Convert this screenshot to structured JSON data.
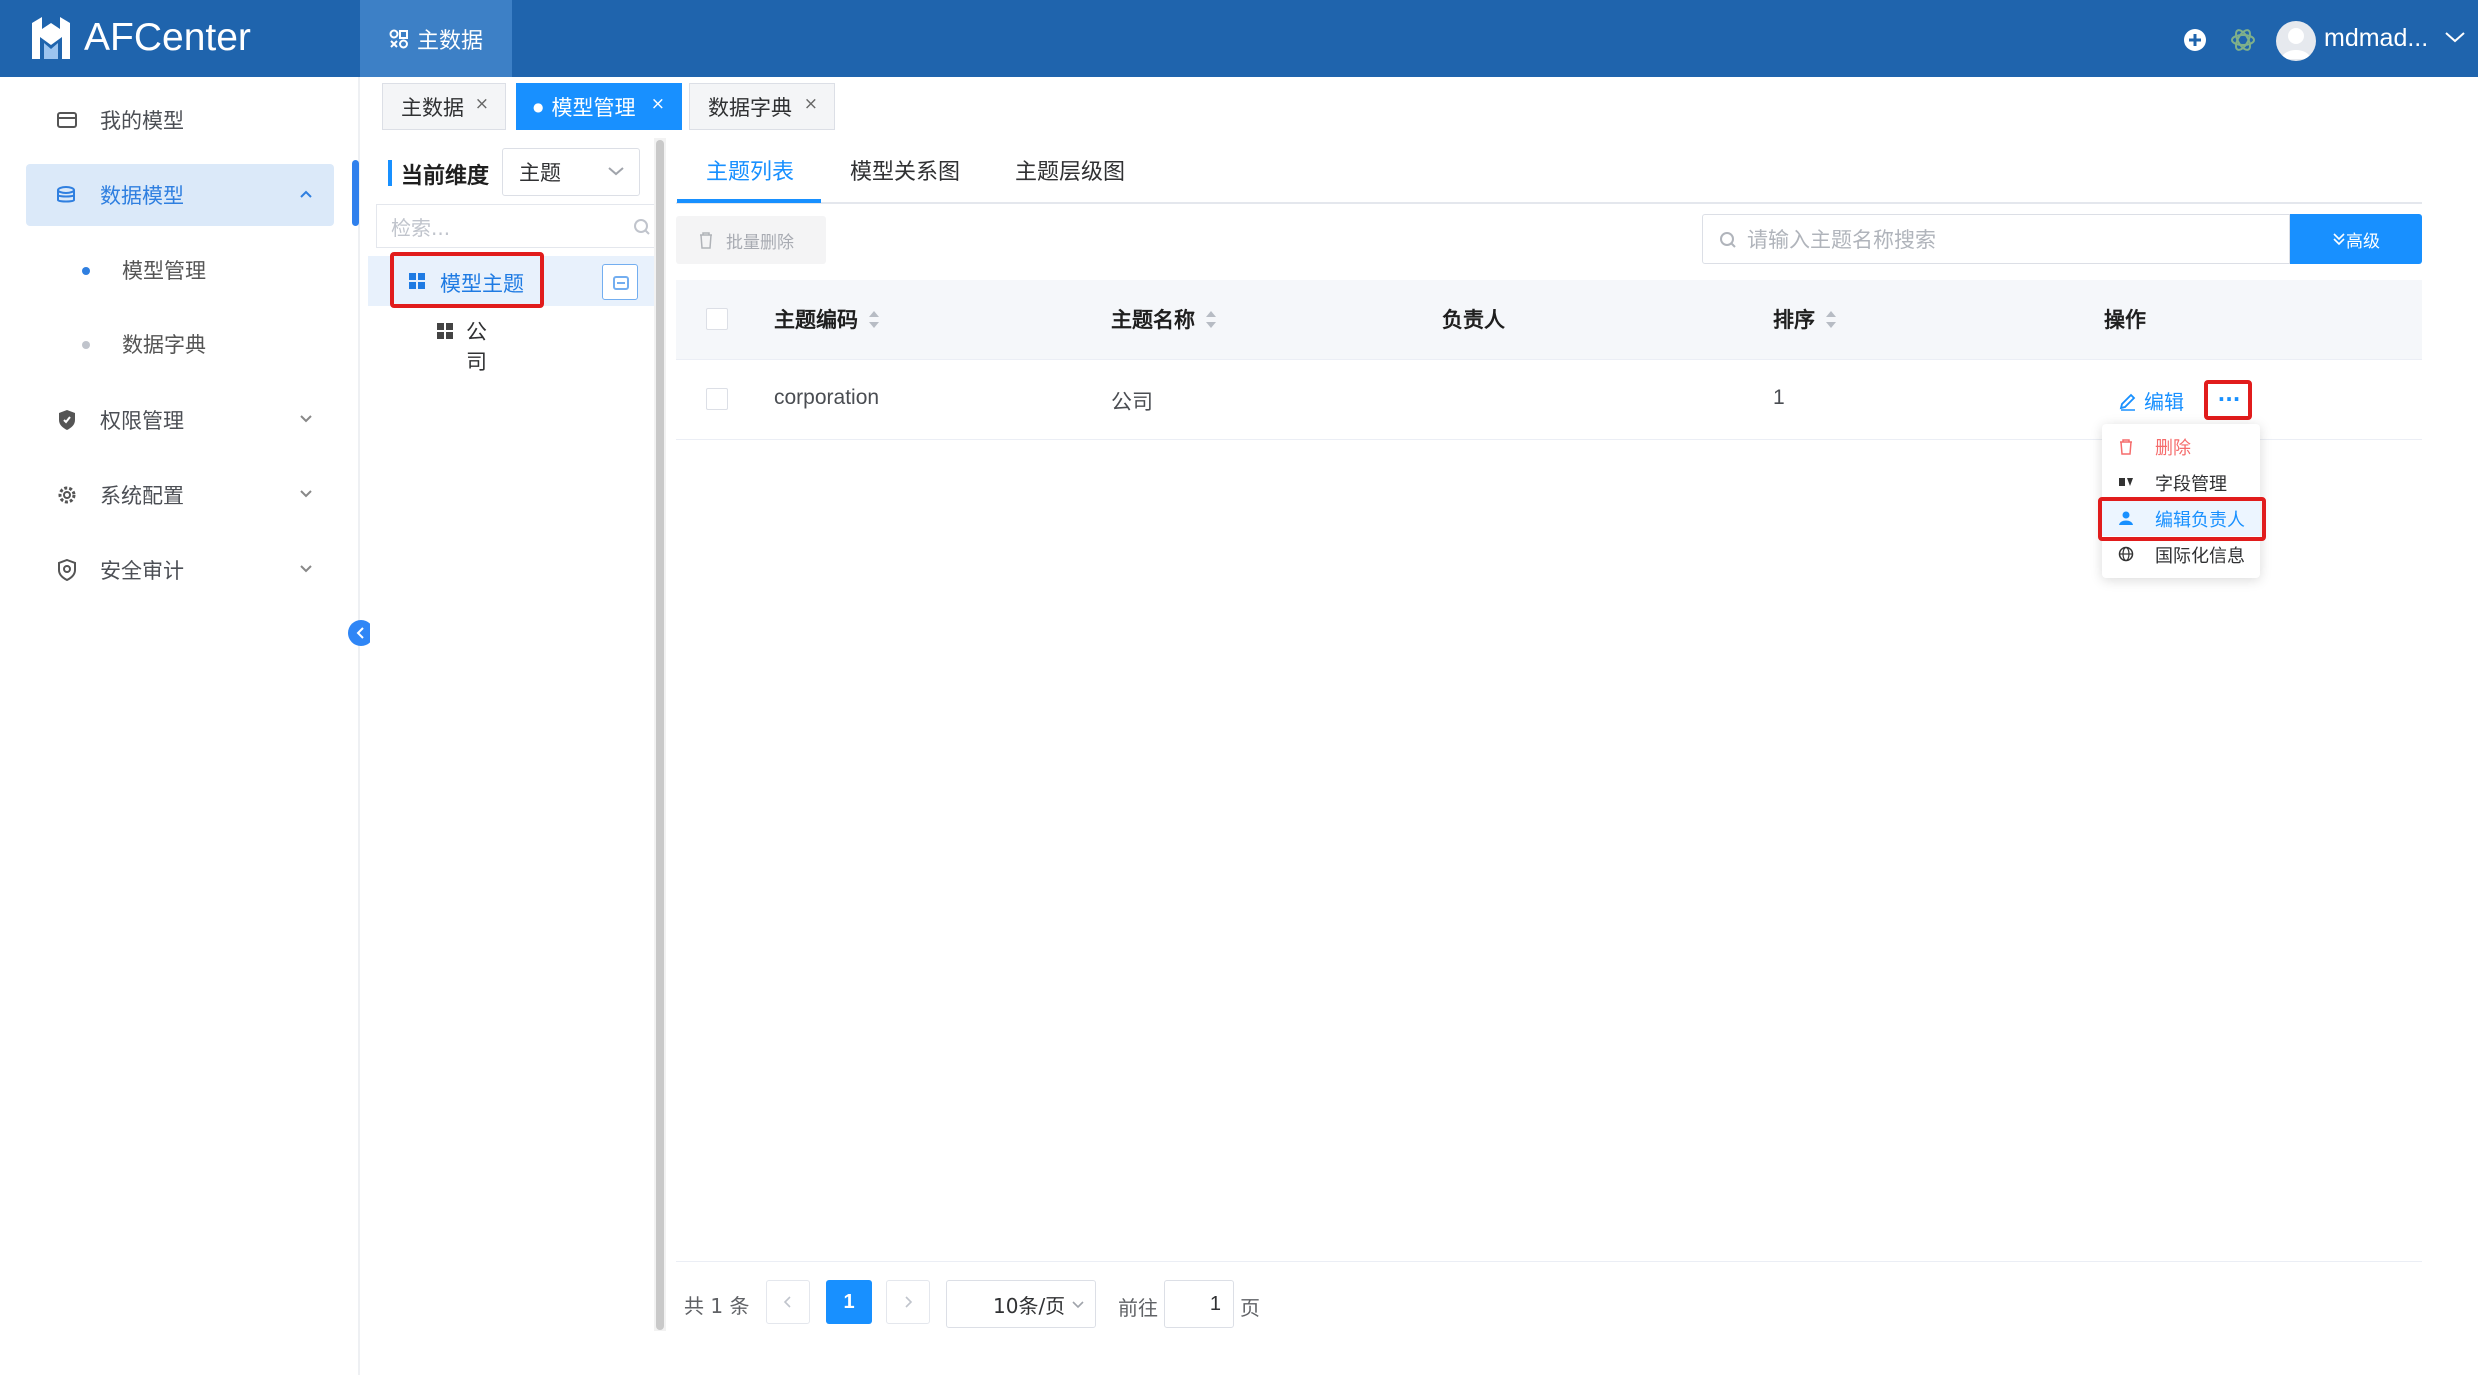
{
  "app": {
    "title": "AFCenter"
  },
  "header": {
    "nav_tab": "主数据",
    "user_name": "mdmad..."
  },
  "sidebar": {
    "items": [
      {
        "label": "我的模型",
        "icon": "wallet-icon"
      },
      {
        "label": "数据模型",
        "icon": "database-icon",
        "active": true
      },
      {
        "label": "权限管理",
        "icon": "shield-icon"
      },
      {
        "label": "系统配置",
        "icon": "gear-icon"
      },
      {
        "label": "安全审计",
        "icon": "audit-shield-icon"
      }
    ],
    "subitems": [
      {
        "label": "模型管理",
        "active": true
      },
      {
        "label": "数据字典"
      }
    ]
  },
  "page_tabs": [
    {
      "label": "主数据"
    },
    {
      "label": "模型管理",
      "active": true
    },
    {
      "label": "数据字典"
    }
  ],
  "tree": {
    "dimension_label": "当前维度",
    "dimension_value": "主题",
    "search_placeholder": "检索...",
    "root": "模型主题",
    "child": "公司"
  },
  "content_tabs": [
    "主题列表",
    "模型关系图",
    "主题层级图"
  ],
  "toolbar": {
    "batch_delete": "批量删除",
    "search_placeholder": "请输入主题名称搜索",
    "advanced": "高级"
  },
  "table": {
    "columns": [
      "主题编码",
      "主题名称",
      "负责人",
      "排序",
      "操作"
    ],
    "rows": [
      {
        "code": "corporation",
        "name": "公司",
        "owner": "",
        "order": "1",
        "edit": "编辑",
        "more": "···"
      }
    ]
  },
  "dropdown": [
    "删除",
    "字段管理",
    "编辑负责人",
    "国际化信息"
  ],
  "pagination": {
    "total": "共 1 条",
    "current": "1",
    "page_size": "10条/页",
    "goto": "前往",
    "goto_value": "1",
    "page_suffix": "页"
  },
  "colors": {
    "header_bg": "#1f64ad",
    "accent": "#1890ff",
    "highlight": "#e11c1c"
  }
}
